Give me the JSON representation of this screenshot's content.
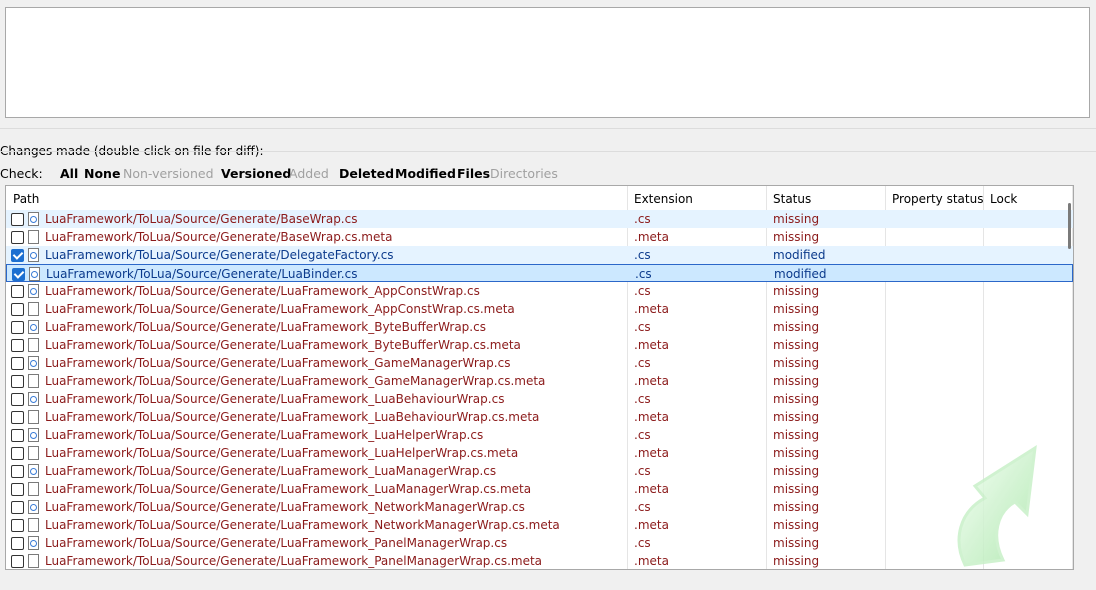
{
  "changes_label": "Changes made (double-click on file for diff):",
  "filters": {
    "check_label": "Check:",
    "all": "All",
    "none": "None",
    "non_versioned": "Non-versioned",
    "versioned": "Versioned",
    "added": "Added",
    "deleted": "Deleted",
    "modified": "Modified",
    "files": "Files",
    "directories": "Directories"
  },
  "columns": {
    "path": "Path",
    "extension": "Extension",
    "status": "Status",
    "property_status": "Property status",
    "lock": "Lock"
  },
  "rows": [
    {
      "checked": false,
      "icon": "cs-file-icon",
      "path": "LuaFramework/ToLua/Source/Generate/BaseWrap.cs",
      "ext": ".cs",
      "status": "missing",
      "state": "hover"
    },
    {
      "checked": false,
      "icon": "file-icon",
      "path": "LuaFramework/ToLua/Source/Generate/BaseWrap.cs.meta",
      "ext": ".meta",
      "status": "missing",
      "state": ""
    },
    {
      "checked": true,
      "icon": "cs-file-icon",
      "path": "LuaFramework/ToLua/Source/Generate/DelegateFactory.cs",
      "ext": ".cs",
      "status": "modified",
      "state": "hover"
    },
    {
      "checked": true,
      "icon": "cs-file-icon",
      "path": "LuaFramework/ToLua/Source/Generate/LuaBinder.cs",
      "ext": ".cs",
      "status": "modified",
      "state": "selected"
    },
    {
      "checked": false,
      "icon": "cs-file-icon",
      "path": "LuaFramework/ToLua/Source/Generate/LuaFramework_AppConstWrap.cs",
      "ext": ".cs",
      "status": "missing",
      "state": ""
    },
    {
      "checked": false,
      "icon": "file-icon",
      "path": "LuaFramework/ToLua/Source/Generate/LuaFramework_AppConstWrap.cs.meta",
      "ext": ".meta",
      "status": "missing",
      "state": ""
    },
    {
      "checked": false,
      "icon": "cs-file-icon",
      "path": "LuaFramework/ToLua/Source/Generate/LuaFramework_ByteBufferWrap.cs",
      "ext": ".cs",
      "status": "missing",
      "state": ""
    },
    {
      "checked": false,
      "icon": "file-icon",
      "path": "LuaFramework/ToLua/Source/Generate/LuaFramework_ByteBufferWrap.cs.meta",
      "ext": ".meta",
      "status": "missing",
      "state": ""
    },
    {
      "checked": false,
      "icon": "cs-file-icon",
      "path": "LuaFramework/ToLua/Source/Generate/LuaFramework_GameManagerWrap.cs",
      "ext": ".cs",
      "status": "missing",
      "state": ""
    },
    {
      "checked": false,
      "icon": "file-icon",
      "path": "LuaFramework/ToLua/Source/Generate/LuaFramework_GameManagerWrap.cs.meta",
      "ext": ".meta",
      "status": "missing",
      "state": ""
    },
    {
      "checked": false,
      "icon": "cs-file-icon",
      "path": "LuaFramework/ToLua/Source/Generate/LuaFramework_LuaBehaviourWrap.cs",
      "ext": ".cs",
      "status": "missing",
      "state": ""
    },
    {
      "checked": false,
      "icon": "file-icon",
      "path": "LuaFramework/ToLua/Source/Generate/LuaFramework_LuaBehaviourWrap.cs.meta",
      "ext": ".meta",
      "status": "missing",
      "state": ""
    },
    {
      "checked": false,
      "icon": "cs-file-icon",
      "path": "LuaFramework/ToLua/Source/Generate/LuaFramework_LuaHelperWrap.cs",
      "ext": ".cs",
      "status": "missing",
      "state": ""
    },
    {
      "checked": false,
      "icon": "file-icon",
      "path": "LuaFramework/ToLua/Source/Generate/LuaFramework_LuaHelperWrap.cs.meta",
      "ext": ".meta",
      "status": "missing",
      "state": ""
    },
    {
      "checked": false,
      "icon": "cs-file-icon",
      "path": "LuaFramework/ToLua/Source/Generate/LuaFramework_LuaManagerWrap.cs",
      "ext": ".cs",
      "status": "missing",
      "state": ""
    },
    {
      "checked": false,
      "icon": "file-icon",
      "path": "LuaFramework/ToLua/Source/Generate/LuaFramework_LuaManagerWrap.cs.meta",
      "ext": ".meta",
      "status": "missing",
      "state": ""
    },
    {
      "checked": false,
      "icon": "cs-file-icon",
      "path": "LuaFramework/ToLua/Source/Generate/LuaFramework_NetworkManagerWrap.cs",
      "ext": ".cs",
      "status": "missing",
      "state": ""
    },
    {
      "checked": false,
      "icon": "file-icon",
      "path": "LuaFramework/ToLua/Source/Generate/LuaFramework_NetworkManagerWrap.cs.meta",
      "ext": ".meta",
      "status": "missing",
      "state": ""
    },
    {
      "checked": false,
      "icon": "cs-file-icon",
      "path": "LuaFramework/ToLua/Source/Generate/LuaFramework_PanelManagerWrap.cs",
      "ext": ".cs",
      "status": "missing",
      "state": ""
    },
    {
      "checked": false,
      "icon": "file-icon",
      "path": "LuaFramework/ToLua/Source/Generate/LuaFramework_PanelManagerWrap.cs.meta",
      "ext": ".meta",
      "status": "missing",
      "state": ""
    }
  ],
  "colors": {
    "missing_text": "#8b1a1a",
    "modified_text": "#0b3a8c",
    "selection_bg": "#cce8ff",
    "hover_bg": "#e5f3ff",
    "checkbox_on": "#1c6fd1"
  },
  "watermark_icon": "tortoisesvn-commit-arrow-icon"
}
